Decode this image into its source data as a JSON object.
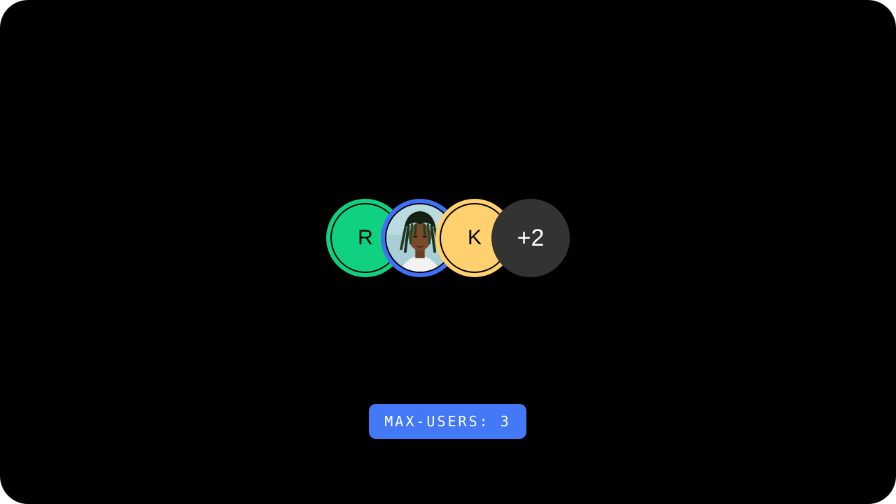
{
  "avatar_group": {
    "avatars": [
      {
        "type": "initial",
        "initial": "R",
        "color": "#0fd17f"
      },
      {
        "type": "photo",
        "color": "#3f70f6"
      },
      {
        "type": "initial",
        "initial": "K",
        "color": "#ffd06e"
      }
    ],
    "overflow": {
      "label": "+2",
      "color": "#333333"
    }
  },
  "badge": {
    "label": "MAX-USERS: 3",
    "color": "#4378f6"
  }
}
